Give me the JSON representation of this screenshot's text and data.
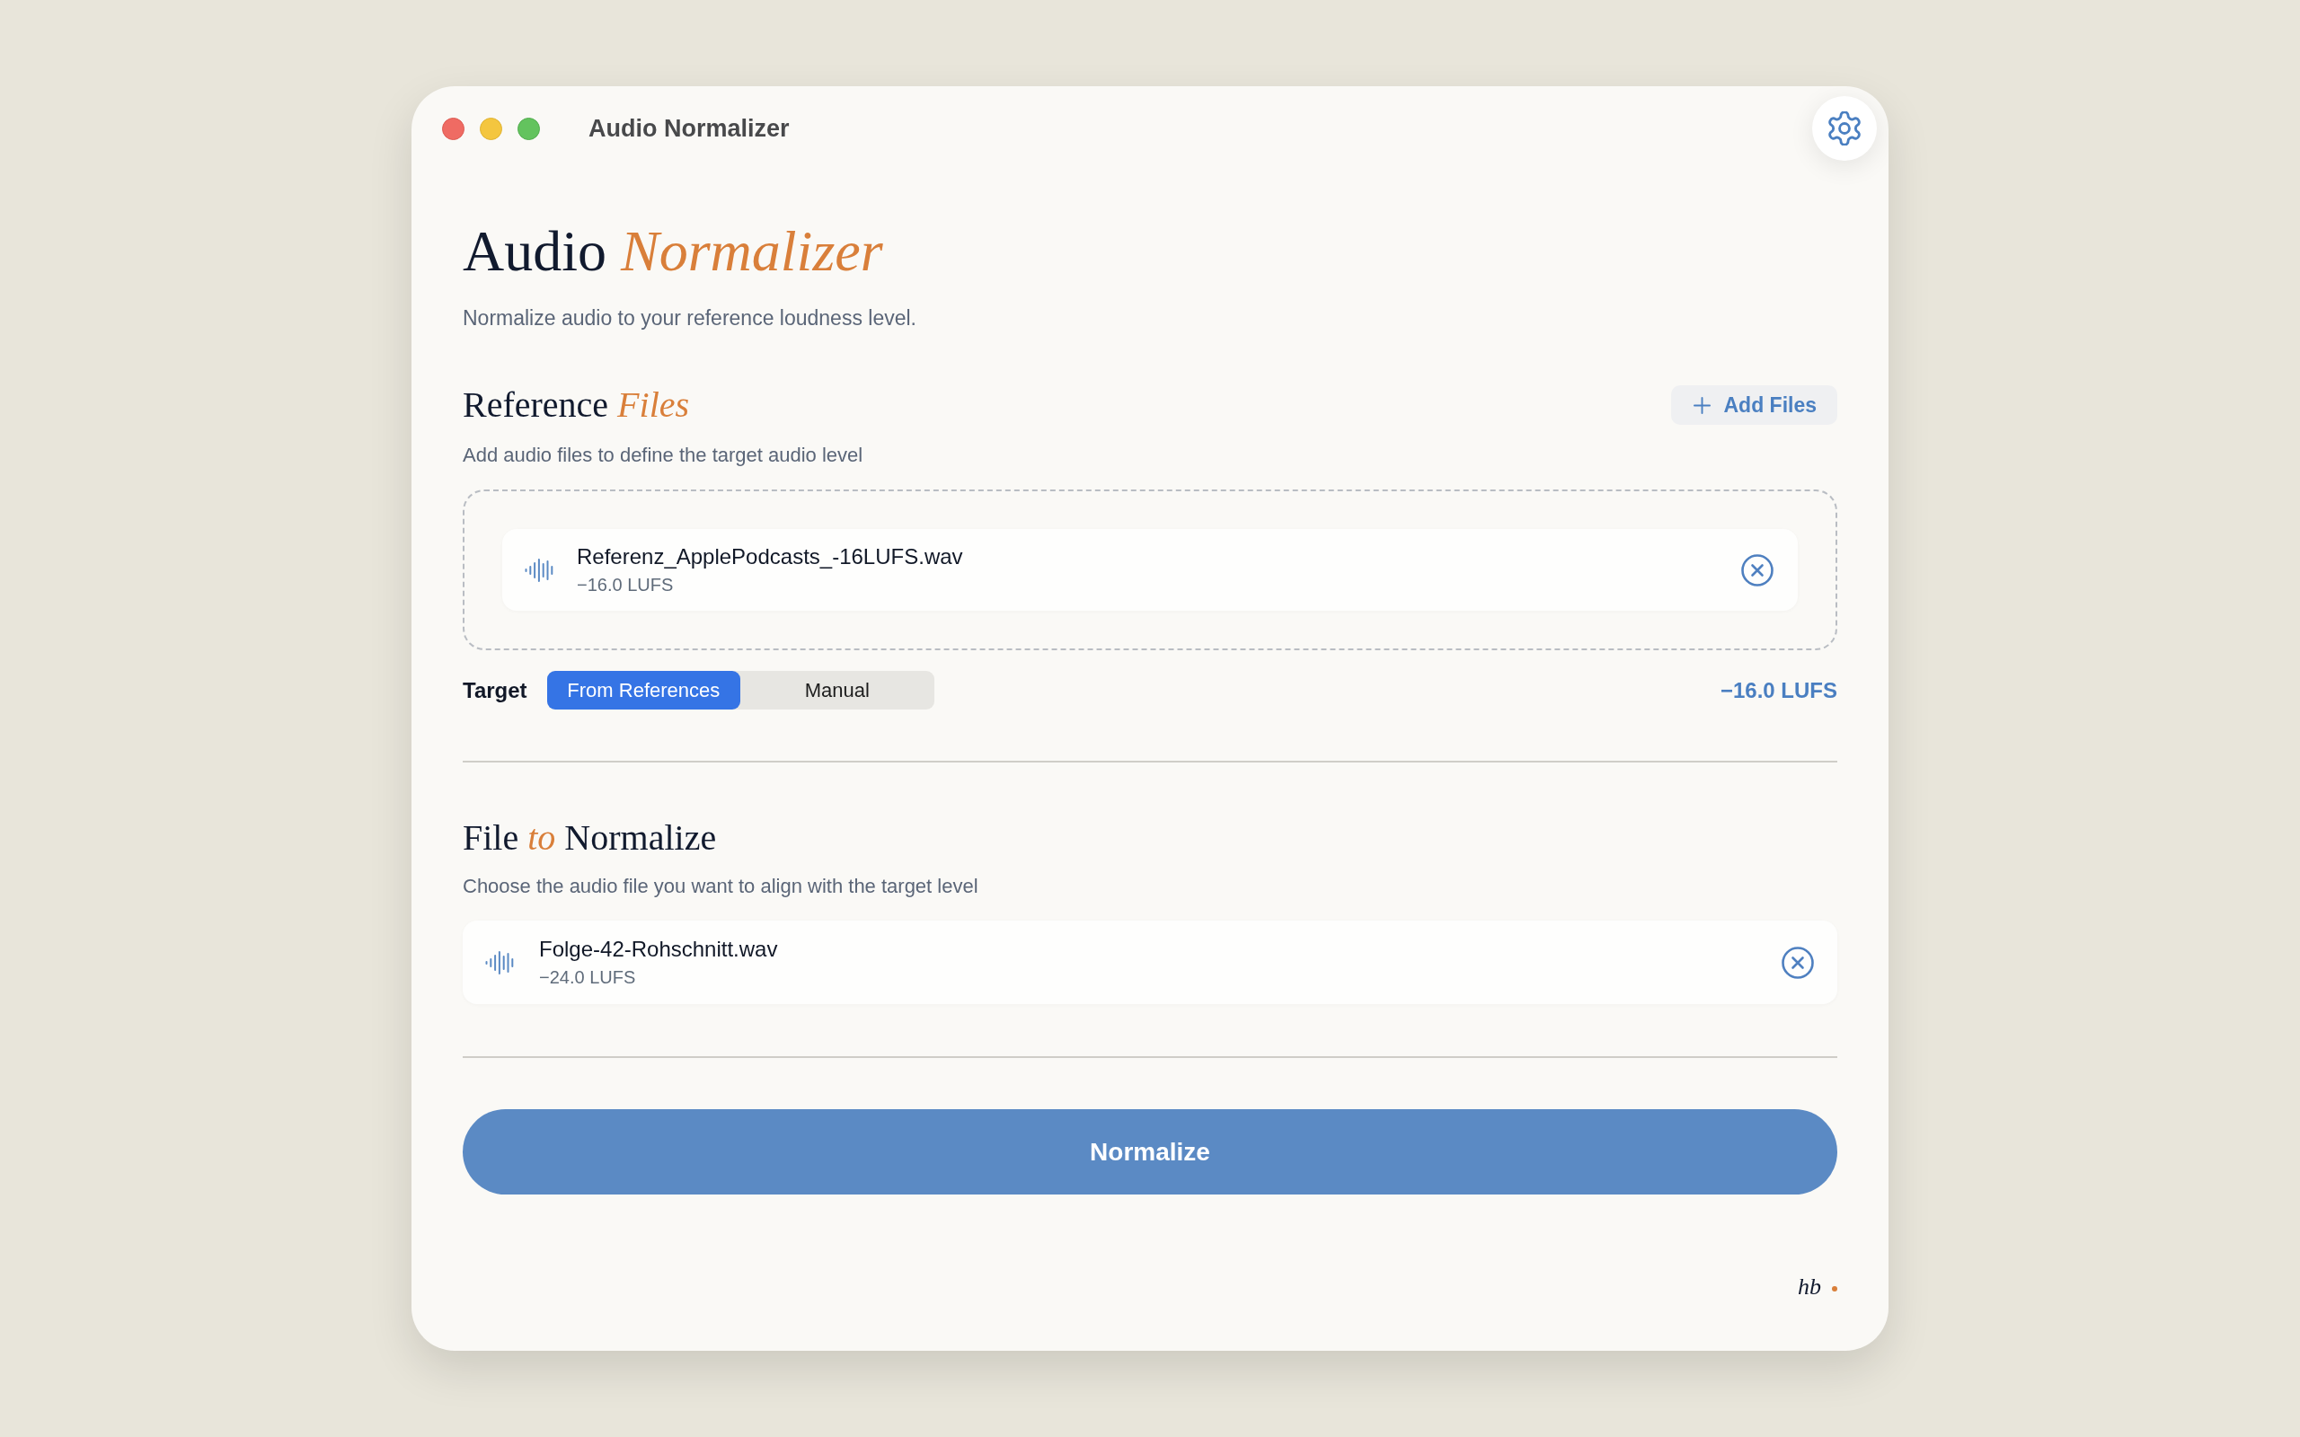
{
  "window": {
    "title": "Audio Normalizer"
  },
  "header": {
    "title": "Audio *Normalizer*",
    "subtitle": "Normalize audio to your reference loudness level."
  },
  "reference_section": {
    "title": "Reference *Files*",
    "subtitle": "Add audio files to define the target audio level",
    "add_button": "Add Files",
    "files": [
      {
        "name": "Referenz_ApplePodcasts_-16LUFS.wav",
        "loudness": "−16.0 LUFS"
      }
    ],
    "target": {
      "label": "Target",
      "options": [
        {
          "label": "From References",
          "selected": true
        },
        {
          "label": "Manual",
          "selected": false
        }
      ],
      "value": "−16.0 LUFS"
    }
  },
  "normalize_section": {
    "title": "File *to* Normalize",
    "subtitle": "Choose the audio file you want to align with the target level",
    "files": [
      {
        "name": "Folge-42-Rohschnitt.wav",
        "loudness": "−24.0 LUFS"
      }
    ]
  },
  "normalize_button": "Normalize",
  "footer": {
    "signature": "hb"
  }
}
